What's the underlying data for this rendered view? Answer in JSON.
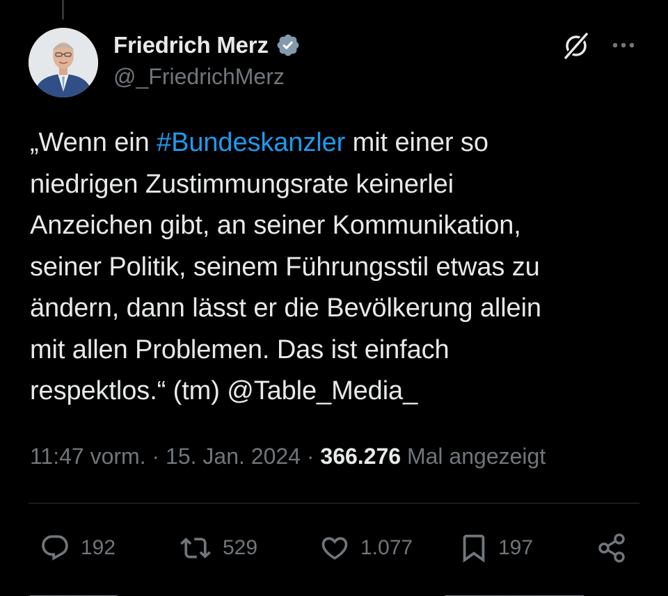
{
  "author": {
    "display_name": "Friedrich Merz",
    "handle": "@_FriedrichMerz",
    "verified": true
  },
  "tweet": {
    "segments": [
      {
        "text": "„Wenn ein ",
        "type": "text"
      },
      {
        "text": "#Bundeskanzler",
        "type": "hashtag"
      },
      {
        "text": " mit einer so\nniedrigen Zustimmungsrate keinerlei\nAnzeichen gibt, an seiner Kommunikation,\nseiner Politik, seinem Führungsstil etwas zu\nändern, dann lässt er die Bevölkerung allein\nmit allen Problemen. Das ist einfach\nrespektlos.“ (tm) @Table_Media_",
        "type": "text"
      }
    ]
  },
  "meta": {
    "time": "11:47 vorm.",
    "separator": " · ",
    "date": "15. Jan. 2024",
    "views_count": "366.276",
    "views_label": " Mal angezeigt"
  },
  "actions": {
    "replies": "192",
    "reposts": "529",
    "likes": "1.077",
    "bookmarks": "197"
  },
  "icons": {
    "verified": "verified-badge-icon",
    "grok": "grok-icon",
    "more": "more-icon",
    "reply": "reply-icon",
    "repost": "repost-icon",
    "like": "heart-icon",
    "bookmark": "bookmark-icon",
    "share": "share-icon"
  },
  "colors": {
    "background": "#000000",
    "text": "#e7e9ea",
    "secondary": "#71767b",
    "accent": "#1d9bf0",
    "verified": "#829aab",
    "divider": "#2f3336"
  }
}
